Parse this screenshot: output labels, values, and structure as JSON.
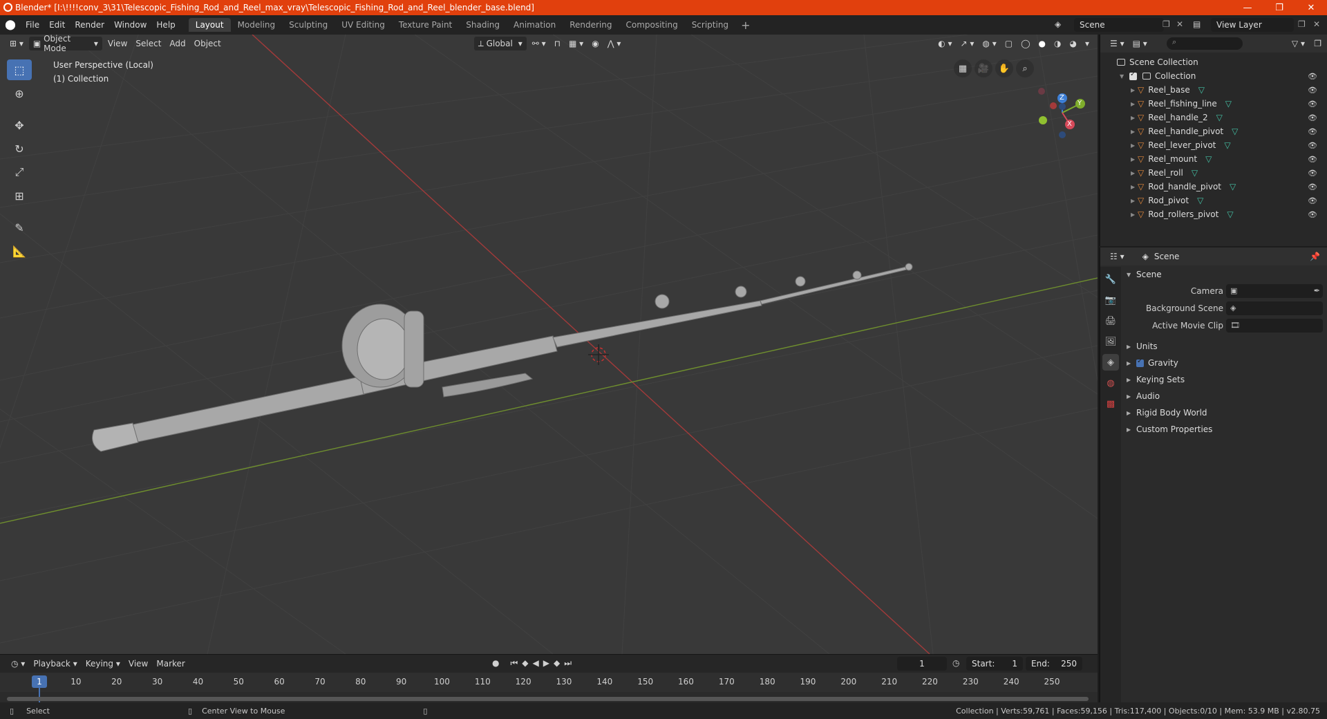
{
  "window": {
    "title": "Blender* [I:\\!!!!conv_3\\31\\Telescopic_Fishing_Rod_and_Reel_max_vray\\Telescopic_Fishing_Rod_and_Reel_blender_base.blend]",
    "minimize": "—",
    "maximize": "❐",
    "close": "✕"
  },
  "menu": [
    "File",
    "Edit",
    "Render",
    "Window",
    "Help"
  ],
  "workspaces": [
    "Layout",
    "Modeling",
    "Sculpting",
    "UV Editing",
    "Texture Paint",
    "Shading",
    "Animation",
    "Rendering",
    "Compositing",
    "Scripting"
  ],
  "workspace_add": "+",
  "scene_name": "Scene",
  "view_layer_name": "View Layer",
  "viewport": {
    "mode": "Object Mode",
    "menus": [
      "View",
      "Select",
      "Add",
      "Object"
    ],
    "transform_orientation": "Global",
    "info_line1": "User Perspective (Local)",
    "info_line2": "(1) Collection",
    "gizmo": {
      "x": "X",
      "y": "Y",
      "z": "Z"
    }
  },
  "timeline": {
    "menus": [
      "Playback",
      "Keying",
      "View",
      "Marker"
    ],
    "current_frame": "1",
    "start_label": "Start:",
    "start_value": "1",
    "end_label": "End:",
    "end_value": "250",
    "ruler": [
      "1",
      "10",
      "20",
      "30",
      "40",
      "50",
      "60",
      "70",
      "80",
      "90",
      "100",
      "110",
      "120",
      "130",
      "140",
      "150",
      "160",
      "170",
      "180",
      "190",
      "200",
      "210",
      "220",
      "230",
      "240",
      "250"
    ]
  },
  "outliner": {
    "root": "Scene Collection",
    "collection": "Collection",
    "objects": [
      "Reel_base",
      "Reel_fishing_line",
      "Reel_handle_2",
      "Reel_handle_pivot",
      "Reel_lever_pivot",
      "Reel_mount",
      "Reel_roll",
      "Rod_handle_pivot",
      "Rod_pivot",
      "Rod_rollers_pivot"
    ]
  },
  "properties": {
    "context": "Scene",
    "panel": "Scene",
    "camera_label": "Camera",
    "background_scene_label": "Background Scene",
    "active_movie_clip_label": "Active Movie Clip",
    "subpanels": [
      "Units",
      "Gravity",
      "Keying Sets",
      "Audio",
      "Rigid Body World",
      "Custom Properties"
    ]
  },
  "status": {
    "left_action": "Select",
    "middle_action": "Center View to Mouse",
    "stats": "Collection | Verts:59,761 | Faces:59,156 | Tris:117,400 | Objects:0/10 | Mem: 53.9 MB | v2.80.75"
  }
}
